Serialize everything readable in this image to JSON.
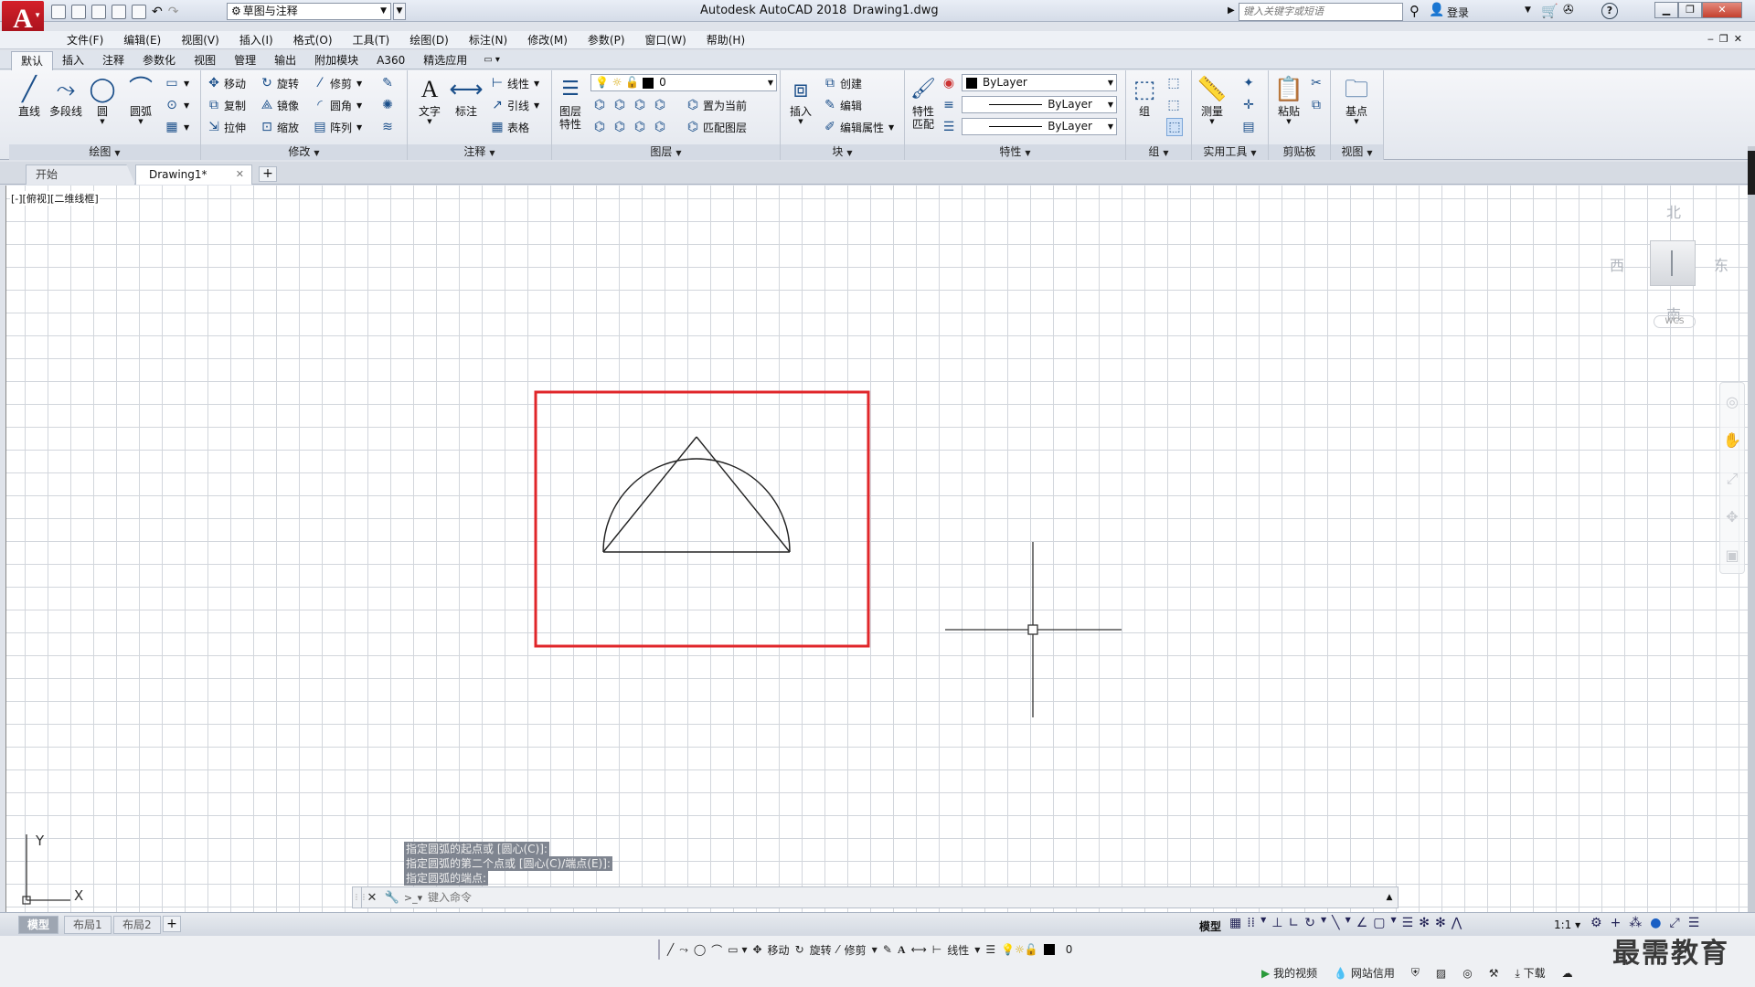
{
  "app": {
    "title": "Autodesk AutoCAD 2018",
    "file": "Drawing1.dwg",
    "logo_letter": "A",
    "workspace": "草图与注释",
    "search_placeholder": "键入关键字或短语",
    "login_label": "登录"
  },
  "menu": [
    "文件(F)",
    "编辑(E)",
    "视图(V)",
    "插入(I)",
    "格式(O)",
    "工具(T)",
    "绘图(D)",
    "标注(N)",
    "修改(M)",
    "参数(P)",
    "窗口(W)",
    "帮助(H)"
  ],
  "ribbon_tabs": [
    "默认",
    "插入",
    "注释",
    "参数化",
    "视图",
    "管理",
    "输出",
    "附加模块",
    "A360",
    "精选应用"
  ],
  "ribbon": {
    "draw": {
      "title": "绘图",
      "line": "直线",
      "polyline": "多段线",
      "circle": "圆",
      "arc": "圆弧"
    },
    "modify": {
      "title": "修改",
      "move": "移动",
      "rotate": "旋转",
      "trim": "修剪",
      "copy": "复制",
      "mirror": "镜像",
      "fillet": "圆角",
      "stretch": "拉伸",
      "scale": "缩放",
      "array": "阵列"
    },
    "annotation": {
      "title": "注释",
      "text": "文字",
      "dimension": "标注",
      "linear": "线性",
      "leader": "引线",
      "table": "表格"
    },
    "layers": {
      "title": "图层",
      "properties_line1": "图层",
      "properties_line2": "特性",
      "current_layer": "0",
      "set_current": "置为当前",
      "match_layer": "匹配图层"
    },
    "block": {
      "title": "块",
      "insert": "插入",
      "create": "创建",
      "edit": "编辑",
      "edit_attr": "编辑属性"
    },
    "properties": {
      "title": "特性",
      "match_line1": "特性",
      "match_line2": "匹配",
      "color": "ByLayer",
      "linetype": "ByLayer",
      "lineweight": "ByLayer"
    },
    "groups": {
      "title": "组",
      "group": "组"
    },
    "utilities": {
      "title": "实用工具",
      "measure": "测量"
    },
    "clipboard": {
      "title": "剪贴板",
      "paste": "粘贴"
    },
    "view": {
      "title": "视图",
      "base": "基点"
    }
  },
  "doc_tabs": {
    "start": "开始",
    "drawing": "Drawing1*"
  },
  "viewport_label": "[-][俯视][二维线框]",
  "viewcube": {
    "north": "北",
    "south": "南",
    "east": "东",
    "west": "西",
    "wcs": "WCS"
  },
  "ucs": {
    "x": "X",
    "y": "Y"
  },
  "command": {
    "history": [
      "指定圆弧的起点或 [圆心(C)]:",
      "指定圆弧的第二个点或 [圆心(C)/端点(E)]:",
      "指定圆弧的端点:"
    ],
    "placeholder": "键入命令"
  },
  "layout_tabs": [
    "模型",
    "布局1",
    "布局2"
  ],
  "status": {
    "model": "模型",
    "scale": "1:1"
  },
  "lower_toolbar": {
    "move": "移动",
    "rotate": "旋转",
    "trim": "修剪",
    "linear": "线性",
    "layer": "0"
  },
  "lower_status": {
    "my_video": "我的视频",
    "net_credit": "网站信用",
    "download": "下载"
  },
  "watermark": "最需教育"
}
